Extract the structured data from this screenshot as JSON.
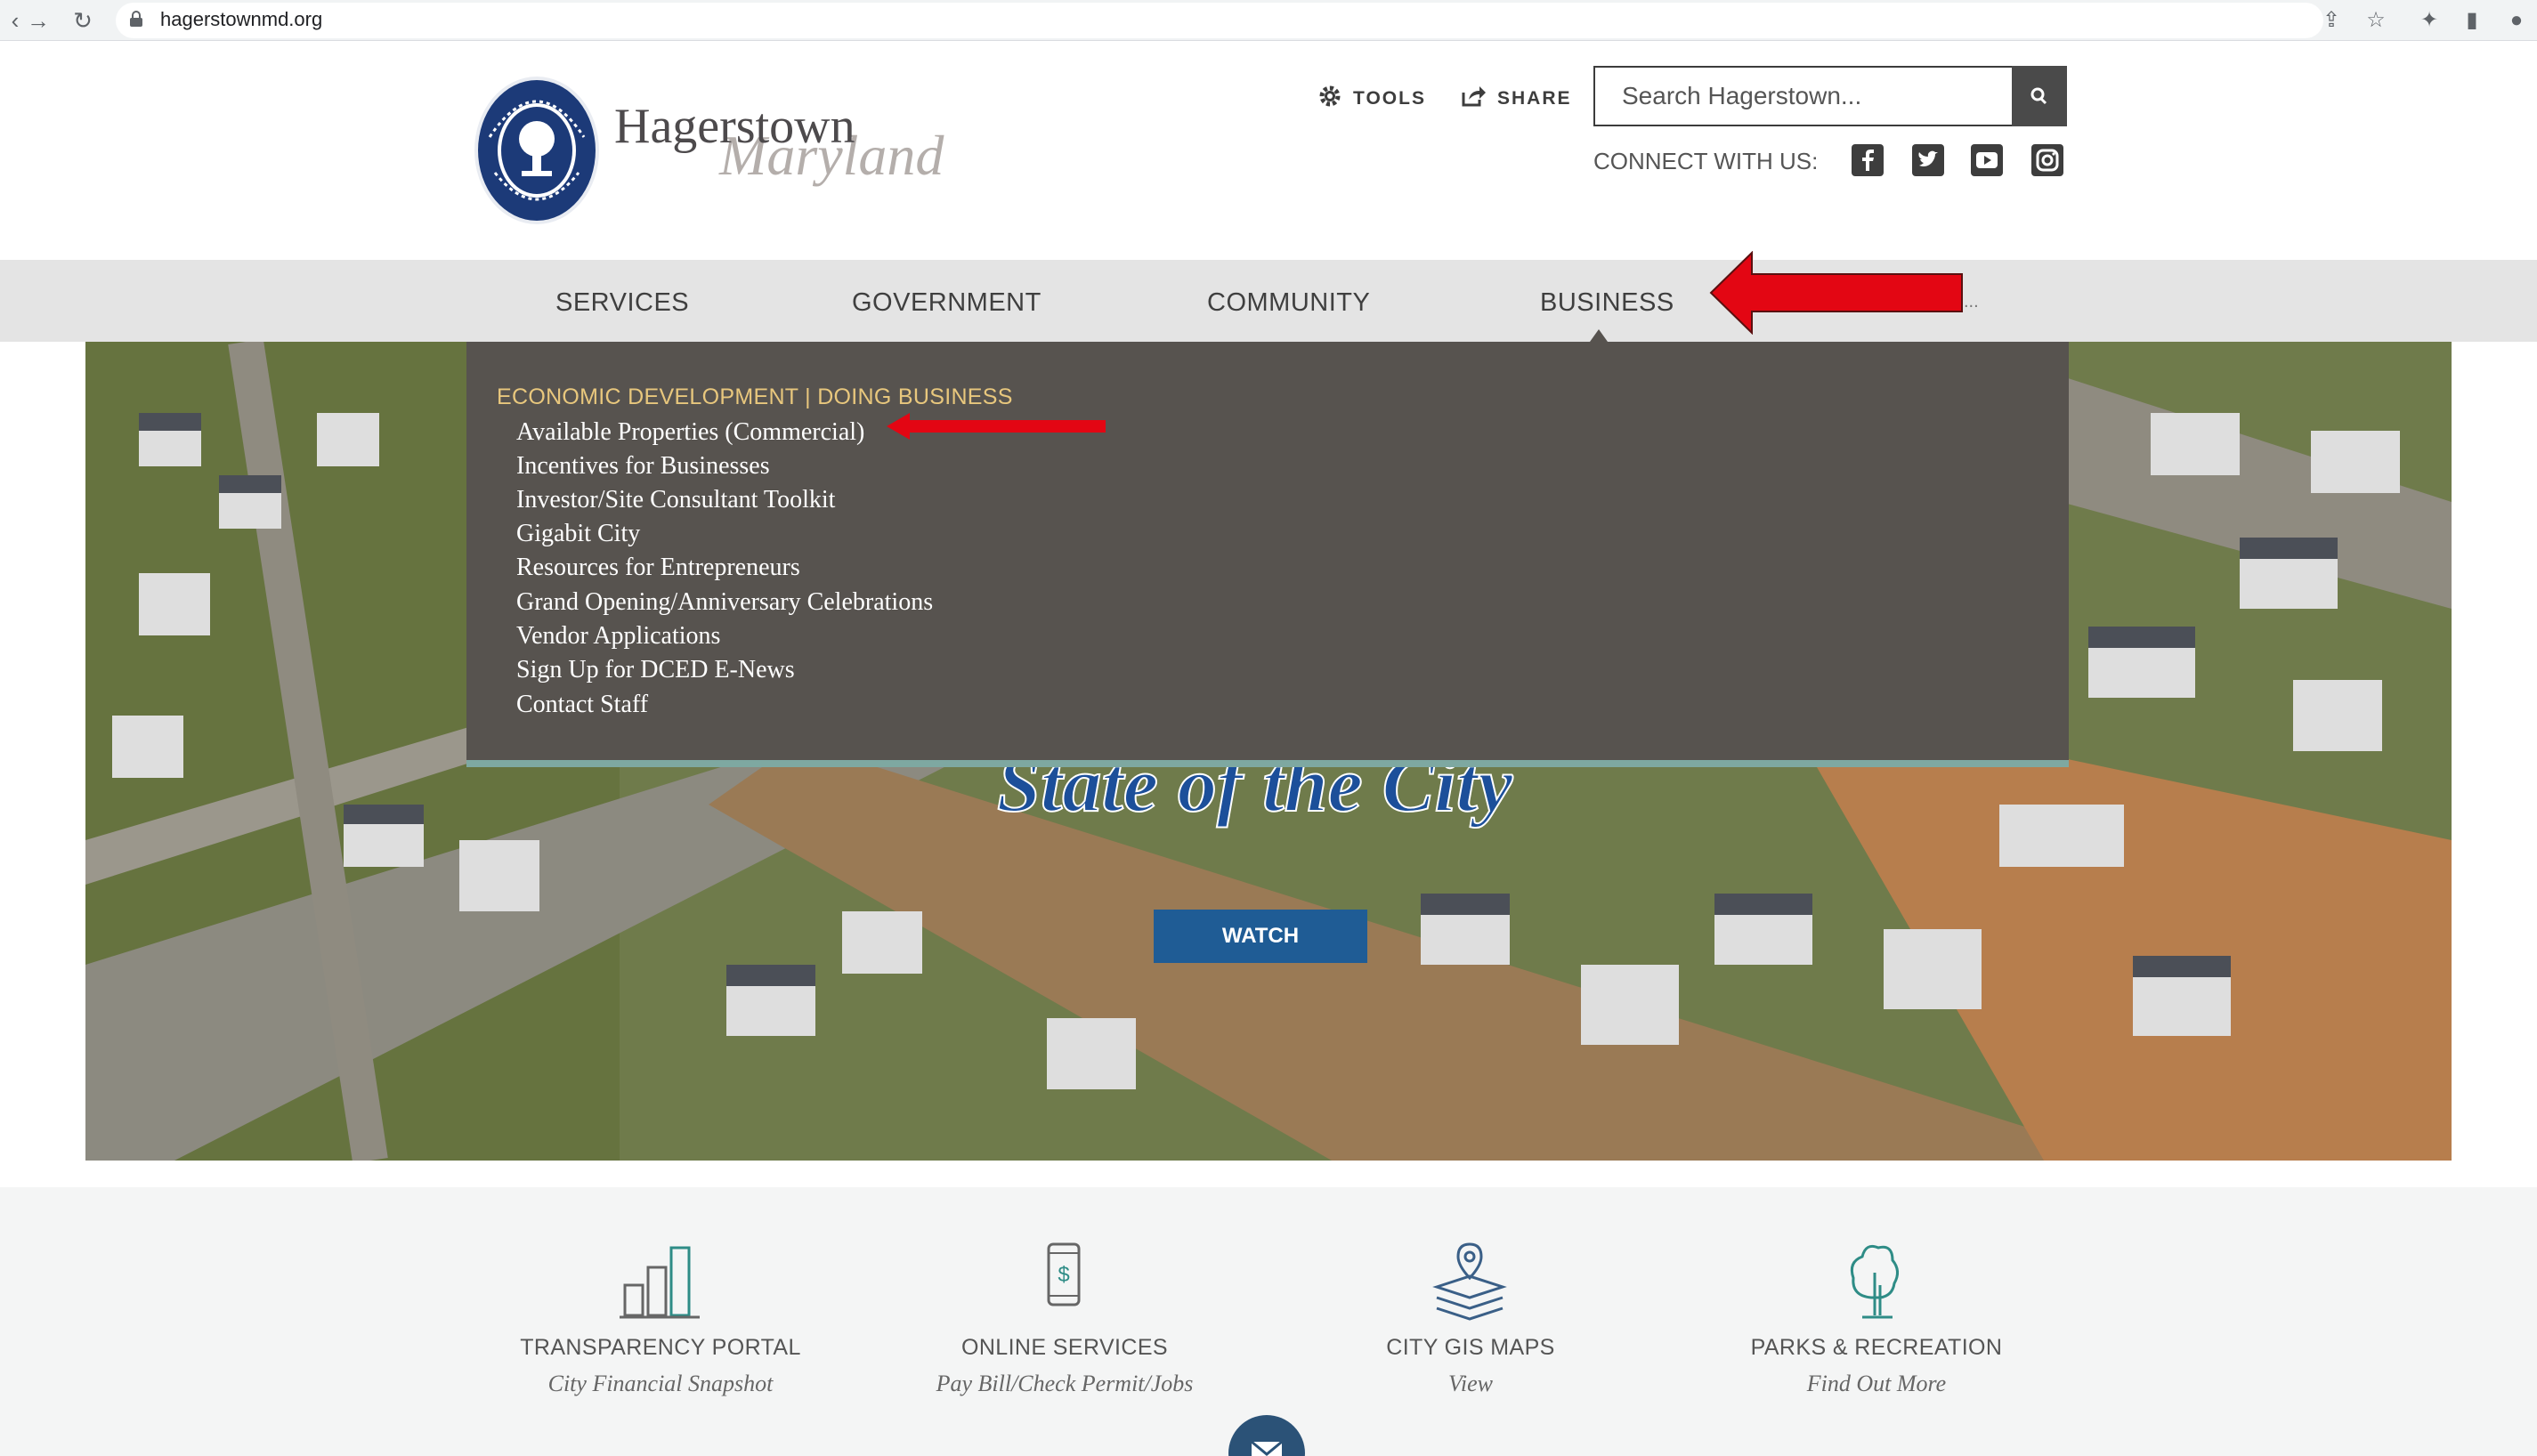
{
  "browser": {
    "url": "hagerstownmd.org"
  },
  "header": {
    "brand_primary": "Hagerstown",
    "brand_secondary": "Maryland",
    "seal_text": "CITY OF HAGERSTOWN MARYLAND",
    "tools_label": "TOOLS",
    "share_label": "SHARE",
    "search_placeholder": "Search Hagerstown...",
    "connect_label": "CONNECT WITH US:",
    "social_icons": [
      "facebook-icon",
      "twitter-icon",
      "youtube-icon",
      "instagram-icon"
    ]
  },
  "nav": {
    "items": [
      {
        "label": "SERVICES"
      },
      {
        "label": "GOVERNMENT"
      },
      {
        "label": "COMMUNITY"
      },
      {
        "label": "BUSINESS",
        "active": true
      }
    ],
    "more": "..."
  },
  "dropdown": {
    "heading": "ECONOMIC DEVELOPMENT | DOING BUSINESS",
    "items": [
      {
        "label": "Available Properties (Commercial)"
      },
      {
        "label": "Incentives for Businesses"
      },
      {
        "label": "Investor/Site Consultant Toolkit"
      },
      {
        "label": "Gigabit City"
      },
      {
        "label": "Resources for Entrepreneurs"
      },
      {
        "label": "Grand Opening/Anniversary Celebrations"
      },
      {
        "label": "Vendor Applications"
      },
      {
        "label": "Sign Up for DCED E-News"
      },
      {
        "label": "Contact Staff"
      }
    ]
  },
  "hero": {
    "title": "State of the City",
    "button_label": "WATCH"
  },
  "quick_links": [
    {
      "title": "TRANSPARENCY PORTAL",
      "subtitle": "City Financial Snapshot",
      "icon": "bar-chart-icon"
    },
    {
      "title": "ONLINE SERVICES",
      "subtitle": "Pay Bill/Check Permit/Jobs",
      "icon": "phone-dollar-icon"
    },
    {
      "title": "CITY GIS MAPS",
      "subtitle": "View",
      "icon": "map-layers-icon"
    },
    {
      "title": "PARKS & RECREATION",
      "subtitle": "Find Out More",
      "icon": "tree-icon"
    }
  ],
  "colors": {
    "nav_bg": "#e4e4e4",
    "dropdown_bg": "#57534f",
    "dropdown_heading": "#e8c77d",
    "dropdown_border": "#7ea8a1",
    "watch_button": "#1f5c95",
    "annotation_arrow": "#e30613",
    "quick_icon_accent": "#2e8c86"
  }
}
